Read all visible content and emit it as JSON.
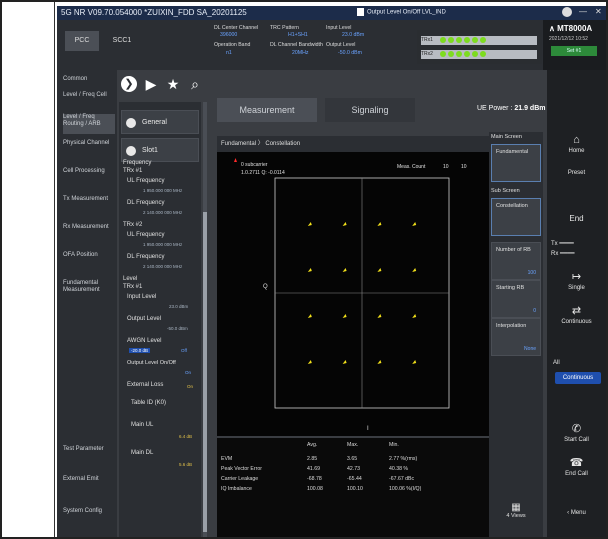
{
  "window": {
    "title": "5G NR V09.70.054000 *ZUIXIN_FDD SA_20201125",
    "output_onoff": "Output Level On/Off",
    "output_onoff_suffix": "LVL_IND"
  },
  "brand": {
    "model": "MT8000A",
    "datetime": "2021/12/12 10:52",
    "set_label": "Set #1"
  },
  "carrier_tabs": [
    {
      "label": "PCC"
    },
    {
      "label": "SCC1"
    }
  ],
  "params": {
    "dl_center_channel": {
      "label": "DL Center Channel",
      "value": "396000"
    },
    "trc_pattern": {
      "label": "TRC Pattern",
      "value": "H1+SH1"
    },
    "input_level": {
      "label": "Input Level",
      "value": "23.0 dBm"
    },
    "operation_band": {
      "label": "Operation Band",
      "value": "n1"
    },
    "dl_channel_bandwidth": {
      "label": "DL Channel Bandwidth",
      "value": "20MHz"
    },
    "output_level": {
      "label": "Output Level",
      "value": "-50.0 dBm"
    }
  },
  "trx_status": [
    {
      "label": "TRx1"
    },
    {
      "label": "TRx2"
    }
  ],
  "left_nav": [
    {
      "label": "Common"
    },
    {
      "label": "Level / Freq Cell"
    },
    {
      "label": "Level / Freq Routing / ARB"
    },
    {
      "label": "Physical Channel"
    },
    {
      "label": "Cell Processing"
    },
    {
      "label": "Tx Measurement"
    },
    {
      "label": "Rx Measurement"
    },
    {
      "label": "OFA Position"
    },
    {
      "label": "Fundamental Measurement"
    },
    {
      "label": "Test Parameter"
    },
    {
      "label": "External Emit"
    },
    {
      "label": "System Config"
    }
  ],
  "tree": {
    "general": "General",
    "slot": "Slot1"
  },
  "param_list": {
    "frequency": "Frequency",
    "trx1": "TRx #1",
    "ul_freq_label": "UL Frequency",
    "ul_freq_value": "1 950.000 000 MHz",
    "dl_freq_label": "DL Frequency",
    "dl_freq_value": "2 140.000 000 MHz",
    "trx2": "TRx #2",
    "ul_freq2_value": "1 950.000 000 MHz",
    "dl_freq2_value": "2 140.000 000 MHz",
    "level": "Level",
    "trx1_level": "TRx #1",
    "input_level": "Input Level",
    "input_level_value": "23.0 dBm",
    "output_level": "Output Level",
    "output_level_value": "-50.0 dBm",
    "awgn_level": "AWGN Level",
    "awgn_value": "-20.0 dB",
    "awgn_state": "Off",
    "output_onoff": "Output Level On/Off",
    "output_onoff_state": "On",
    "external_loss": "External Loss",
    "external_loss_state": "On",
    "table_id": "Table ID (K0)",
    "main_ul": "Main UL",
    "main_ul_value": "6.4 dB",
    "main_dl": "Main DL",
    "main_dl_value": "5.6 dB"
  },
  "main_tabs": [
    {
      "label": "Measurement"
    },
    {
      "label": "Signaling"
    }
  ],
  "ue_power": {
    "label": "UE Power :",
    "value": "21.9 dBm"
  },
  "chart_header": {
    "breadcrumb": "Fundamental 〉 Constellation",
    "dash": "—"
  },
  "chart_data": {
    "type": "scatter",
    "title": "",
    "xlabel": "I",
    "ylabel": "Q",
    "annotation_1": "0 subcarrier",
    "annotation_2": "1.0.2711 Q: -0.0114",
    "meas_count_label": "Meas. Count",
    "meas_count_done": "10",
    "meas_count_total": "10",
    "xlim": [
      -1.5,
      1.5
    ],
    "ylim": [
      -1.5,
      1.5
    ],
    "points": [
      {
        "x": -0.9,
        "y": 0.9
      },
      {
        "x": -0.3,
        "y": 0.9
      },
      {
        "x": 0.3,
        "y": 0.9
      },
      {
        "x": 0.9,
        "y": 0.9
      },
      {
        "x": -0.9,
        "y": 0.3
      },
      {
        "x": -0.3,
        "y": 0.3
      },
      {
        "x": 0.3,
        "y": 0.3
      },
      {
        "x": 0.9,
        "y": 0.3
      },
      {
        "x": -0.9,
        "y": -0.3
      },
      {
        "x": -0.3,
        "y": -0.3
      },
      {
        "x": 0.3,
        "y": -0.3
      },
      {
        "x": 0.9,
        "y": -0.3
      },
      {
        "x": -0.9,
        "y": -0.9
      },
      {
        "x": -0.3,
        "y": -0.9
      },
      {
        "x": 0.3,
        "y": -0.9
      },
      {
        "x": 0.9,
        "y": -0.9
      }
    ],
    "point_color": "#f2e01a"
  },
  "meas_table": {
    "headers": [
      "Avg.",
      "Max.",
      "Min."
    ],
    "rows": [
      {
        "label": "EVM",
        "avg": "2.85",
        "max": "3.65",
        "min": "2.77 %(rms)"
      },
      {
        "label": "Peak Vector Error",
        "avg": "41.69",
        "max": "42.73",
        "min": "40.38 %"
      },
      {
        "label": "Carrier Leakage",
        "avg": "-68.78",
        "max": "-65.44",
        "min": "-67.67 dBc"
      },
      {
        "label": "IQ Imbalance",
        "avg": "100.08",
        "max": "100.10",
        "min": "100.06 %(I/Q)"
      }
    ]
  },
  "right_panel": {
    "main_screen": "Main Screen",
    "fundamental": "Fundamental",
    "sub_screen": "Sub Screen",
    "constellation": "Constellation",
    "num_rb": "Number of RB",
    "num_rb_value": "100",
    "starting_rb": "Starting RB",
    "starting_rb_value": "0",
    "interpolation": "Interpolation",
    "interpolation_value": "None",
    "views": "4 Views"
  },
  "far_right": {
    "home": "Home",
    "preset": "Preset",
    "end": "End",
    "tx": "Tx",
    "rx": "Rx",
    "single": "Single",
    "continuous": "Continuous",
    "all": "All",
    "continue_btn": "Continuous",
    "start_call": "Start Call",
    "end_call": "End Call",
    "menu": "Menu"
  }
}
